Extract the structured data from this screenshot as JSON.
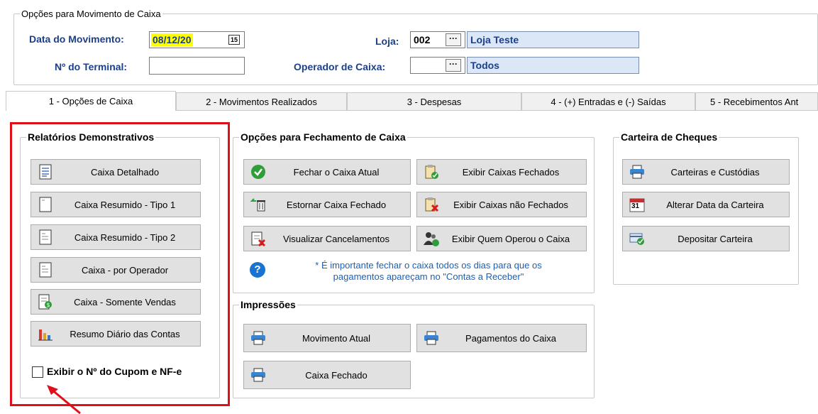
{
  "header": {
    "group_title": "Opções para Movimento de Caixa",
    "data_label": "Data do Movimento:",
    "data_value": "08/12/20",
    "calendar_icon_text": "15",
    "terminal_label": "Nº do Terminal:",
    "terminal_value": "",
    "loja_label": "Loja:",
    "loja_code": "002",
    "loja_name": "Loja Teste",
    "operador_label": "Operador de Caixa:",
    "operador_code": "",
    "operador_name": "Todos",
    "lookup_glyph": "···"
  },
  "tabs": [
    {
      "label": "1 - Opções de Caixa",
      "active": true
    },
    {
      "label": "2 - Movimentos Realizados",
      "active": false
    },
    {
      "label": "3 - Despesas",
      "active": false
    },
    {
      "label": "4 - (+) Entradas e (-) Saídas",
      "active": false
    },
    {
      "label": "5 - Recebimentos Ant",
      "active": false
    }
  ],
  "relatorios": {
    "title": "Relatórios Demonstrativos",
    "buttons": [
      {
        "label": "Caixa Detalhado",
        "icon": "report-list-icon"
      },
      {
        "label": "Caixa Resumido - Tipo 1",
        "icon": "report-blank-icon"
      },
      {
        "label": "Caixa Resumido - Tipo 2",
        "icon": "report-lines-icon"
      },
      {
        "label": "Caixa - por Operador",
        "icon": "report-lines-icon"
      },
      {
        "label": "Caixa - Somente Vendas",
        "icon": "report-money-icon"
      },
      {
        "label": "Resumo Diário das Contas",
        "icon": "bar-chart-icon"
      }
    ],
    "checkbox_label": "Exibir o Nº do Cupom e NF-e",
    "checkbox_checked": false
  },
  "fechamento": {
    "title": "Opções para Fechamento de Caixa",
    "buttons": [
      {
        "label": "Fechar o Caixa Atual",
        "icon": "check-circle-icon"
      },
      {
        "label": "Exibir Caixas Fechados",
        "icon": "clipboard-check-icon"
      },
      {
        "label": "Estornar Caixa Fechado",
        "icon": "undo-trash-icon"
      },
      {
        "label": "Exibir Caixas não Fechados",
        "icon": "clipboard-x-icon"
      },
      {
        "label": "Visualizar Cancelamentos",
        "icon": "document-x-icon"
      },
      {
        "label": "Exibir Quem Operou o Caixa",
        "icon": "users-icon"
      }
    ],
    "note_line1": "* É importante fechar o caixa todos os dias para que os",
    "note_line2": "pagamentos apareçam no \"Contas a Receber\""
  },
  "impressoes": {
    "title": "Impressões",
    "buttons": [
      {
        "label": "Movimento Atual",
        "icon": "printer-icon"
      },
      {
        "label": "Pagamentos do Caixa",
        "icon": "printer-icon"
      },
      {
        "label": "Caixa Fechado",
        "icon": "printer-icon"
      }
    ]
  },
  "carteira": {
    "title": "Carteira de Cheques",
    "buttons": [
      {
        "label": "Carteiras e Custódias",
        "icon": "printer-icon"
      },
      {
        "label": "Alterar Data da Carteira",
        "icon": "calendar-icon"
      },
      {
        "label": "Depositar Carteira",
        "icon": "card-check-icon"
      }
    ],
    "calendar_day": "31"
  },
  "colors": {
    "label_blue": "#1c3f8a",
    "highlight_red": "#e0101a",
    "date_yellow": "#ffff00",
    "readonly_blue": "#dbe6f6"
  }
}
